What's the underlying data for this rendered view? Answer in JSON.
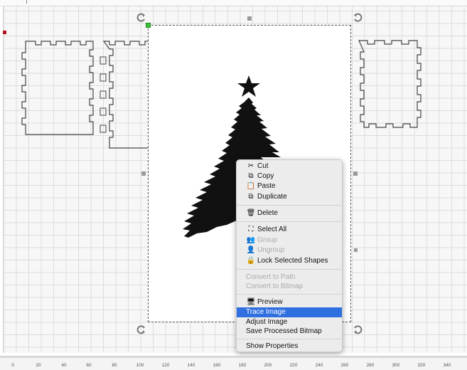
{
  "context_menu": {
    "items": [
      {
        "label": "Cut",
        "icon": "scissors-icon",
        "enabled": true
      },
      {
        "label": "Copy",
        "icon": "copy-icon",
        "enabled": true
      },
      {
        "label": "Paste",
        "icon": "paste-icon",
        "enabled": true
      },
      {
        "label": "Duplicate",
        "icon": "duplicate-icon",
        "enabled": true
      },
      {
        "label": "Delete",
        "icon": "trash-icon",
        "enabled": true
      },
      {
        "label": "Select All",
        "icon": "select-all-icon",
        "enabled": true
      },
      {
        "label": "Group",
        "icon": "group-icon",
        "enabled": false
      },
      {
        "label": "Ungroup",
        "icon": "ungroup-icon",
        "enabled": false
      },
      {
        "label": "Lock Selected Shapes",
        "icon": "lock-icon",
        "enabled": true
      },
      {
        "label": "Convert to Path",
        "enabled": false
      },
      {
        "label": "Convert to Bitmap",
        "enabled": false
      },
      {
        "label": "Preview",
        "icon": "monitor-icon",
        "enabled": true
      },
      {
        "label": "Trace Image",
        "enabled": true,
        "selected": true
      },
      {
        "label": "Adjust Image",
        "enabled": true
      },
      {
        "label": "Save Processed Bitmap",
        "enabled": true
      },
      {
        "label": "Show Properties",
        "enabled": true
      }
    ]
  },
  "ruler": {
    "labels": [
      "0",
      "20",
      "40",
      "60",
      "80",
      "100",
      "120",
      "140",
      "160",
      "180",
      "200",
      "220",
      "240",
      "260",
      "280",
      "300",
      "320",
      "340"
    ]
  },
  "colors": {
    "selection_accent": "#2f6fe0",
    "origin_marker": "#b5121b",
    "anchor_handle": "#3cc13c",
    "grid_line": "#dcdcdc"
  },
  "canvas": {
    "image_content": "christmas-tree-silhouette"
  }
}
